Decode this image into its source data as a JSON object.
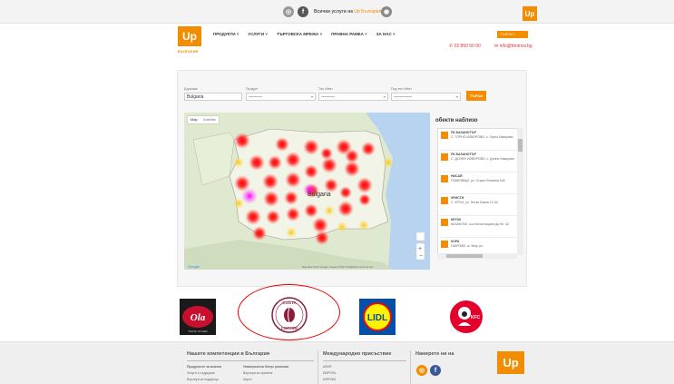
{
  "topbar": {
    "tagline_prefix": "Всички услуги на",
    "tagline_link": "Up България",
    "logo": "Up"
  },
  "header": {
    "logo": "Up",
    "logo_sub": "БЪЛГАРИЯ",
    "nav": [
      "ПРОДУКТИ ˅",
      "УСЛУГИ ˅",
      "ТЪРГОВСКА МРЕЖА ˅",
      "ПРАВНА РАМКА ˅",
      "ЗА НАС ˅"
    ],
    "lang": "ТЪРСИ",
    "phone": "02 850 50 00",
    "email": "info@bmtnov.bg"
  },
  "filters": {
    "country_label": "Държава",
    "country_value": "Bulgaria",
    "product_label": "Продукт",
    "product_value": "---------",
    "type_label": "Тип обект",
    "type_value": "---------",
    "subtype_label": "Под тип обект",
    "subtype_value": "------------",
    "search_button": "ТЪРСИ"
  },
  "map": {
    "tab_map": "Map",
    "tab_sat": "Satellite",
    "country_label": "Bulgaria",
    "attribution": "Map data ©2017 Google, Imagery ©2017 TerraMetrics  Terms of Use"
  },
  "objects": {
    "title": "обекти наблизо",
    "items": [
      {
        "name": "ПК БАЗАНОТЪР",
        "addr": "С. ГОРНО ИЗВОРОВО, с. Горно Изворово"
      },
      {
        "name": "ПК БАЗАНОТЪР",
        "addr": "С. ДОЛНО ИЗВОРОВО, с. Долно Изворово"
      },
      {
        "name": "НИСАЙ",
        "addr": "ПЛАКОВЩИ, ул. Стара Планина ЪВ/"
      },
      {
        "name": "ХРИСТИ",
        "addr": "С. КРЪН, ул. Петко Бакев 12 А2"
      },
      {
        "name": "КЕТОК",
        "addr": "КАЗАНЛЪК, ж.к.Изток къщата до бл. 42"
      },
      {
        "name": "КОРА",
        "addr": "ГАБРОВО, ж. Втор ул."
      }
    ]
  },
  "brands": {
    "ola_text": "TASTE OF RED",
    "ola_logo": "Ola",
    "costa_top": "COSTA",
    "costa_bottom": "COFFEE",
    "lidl": "LIDL",
    "kfc": "KFC"
  },
  "footer": {
    "col1_title": "Нашите компетенции в България",
    "col1_lines": [
      "Продуктите за всички",
      "Универсални бонус решения",
      "Услуги и съдружия",
      "Ваучери за хранене",
      "Ваучери за подаръци",
      "Карти"
    ],
    "col2_title": "Международно присъствие",
    "col2_lines": [
      "АЗИЯ",
      "ЕВРОПА",
      "АФРИКА"
    ],
    "col3_title": "Намерете ни на",
    "logo": "Up"
  },
  "colors": {
    "accent": "#f28c00",
    "hotspot": "#e60000",
    "highlight": "#e00000"
  }
}
